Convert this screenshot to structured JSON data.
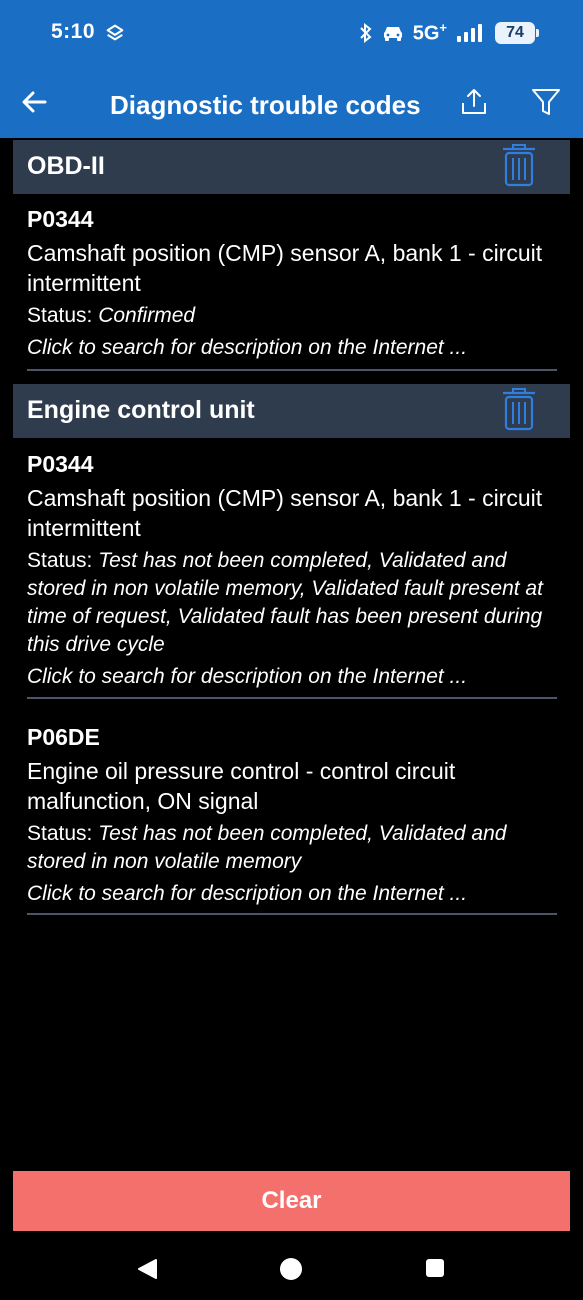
{
  "status_bar": {
    "time": "5:10",
    "network": "5G",
    "network_plus": "+",
    "battery": "74",
    "icons": [
      "data-saver-icon",
      "bluetooth-icon",
      "car-icon",
      "signal-icon",
      "battery-icon"
    ]
  },
  "app_bar": {
    "title": "Diagnostic trouble codes",
    "icons": [
      "back-arrow-icon",
      "share-icon",
      "filter-icon"
    ]
  },
  "colors": {
    "app_bar": "#1a6fc4",
    "section_header": "#2f3c4d",
    "clear_button": "#f4706c",
    "trash_icon": "#2f7fe0",
    "background": "#000000"
  },
  "sections": [
    {
      "title": "OBD-II",
      "codes": [
        {
          "code": "P0344",
          "description": "Camshaft position (CMP) sensor A, bank 1 - circuit intermittent",
          "status_label": "Status: ",
          "status_value": "Confirmed",
          "link": "Click to search for description on the Internet ..."
        }
      ]
    },
    {
      "title": "Engine control unit",
      "codes": [
        {
          "code": "P0344",
          "description": "Camshaft position (CMP) sensor A, bank 1 - circuit intermittent",
          "status_label": "Status: ",
          "status_value": "Test has not been completed, Validated and stored in non volatile memory, Validated fault present at time of request, Validated fault has been present during this drive cycle",
          "link": "Click to search for description on the Internet ..."
        },
        {
          "code": "P06DE",
          "description": "Engine oil pressure control - control circuit malfunction, ON signal",
          "status_label": "Status: ",
          "status_value": "Test has not been completed, Validated and stored in non volatile memory",
          "link": "Click to search for description on the Internet ..."
        }
      ]
    }
  ],
  "clear_button": {
    "label": "Clear"
  }
}
